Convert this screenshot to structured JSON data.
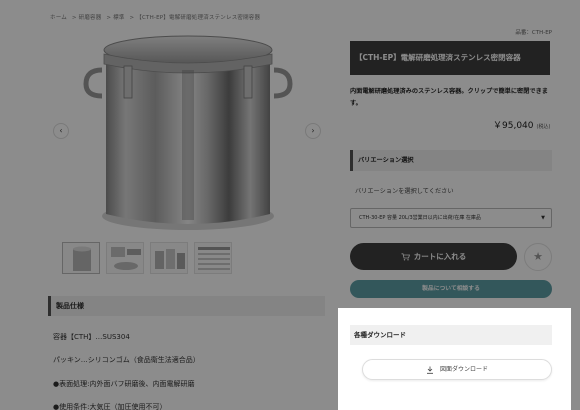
{
  "breadcrumb": [
    "ホーム",
    "> 研磨容器",
    "> 標準",
    "> 【CTH-EP】電解研磨処理済ステンレス密閉容器"
  ],
  "product": {
    "code": "品番：CTH-EP",
    "title": "【CTH-EP】電解研磨処理済ステンレス密閉容器",
    "description": "内面電解研磨処理済みのステンレス容器。クリップで簡単に密閉できます。",
    "price": "￥95,040",
    "tax_note": "(税込)"
  },
  "variation": {
    "heading": "バリエーション選択",
    "note": "バリエーションを選択してください",
    "selected": "CTH-30-EP 容量 20L/3営業日以内に出荷/在庫 在庫品"
  },
  "buttons": {
    "cart": "カートに入れる",
    "consult": "製品について相談する",
    "download": "図面ダウンロード"
  },
  "downloads": {
    "heading": "各種ダウンロード"
  },
  "spec": {
    "heading": "製品仕様",
    "lines": [
      "容器【CTH】…SUS304",
      "パッキン…シリコンゴム（食品衛生法適合品）",
      "●表面処理:内外面バフ研磨後、内面電解研磨",
      "●使用条件:大気圧（加圧使用不可）"
    ]
  },
  "gallery": {
    "prev": "‹",
    "next": "›"
  },
  "icons": {
    "cart": "cart-icon",
    "favorite": "star-icon",
    "download": "download-icon"
  },
  "colors": {
    "title_bg": "#3f3f3f",
    "cart_bg": "#3f3f3f",
    "consult_bg": "#5e9ea6",
    "overlay": "rgba(0,0,0,0.45)"
  }
}
